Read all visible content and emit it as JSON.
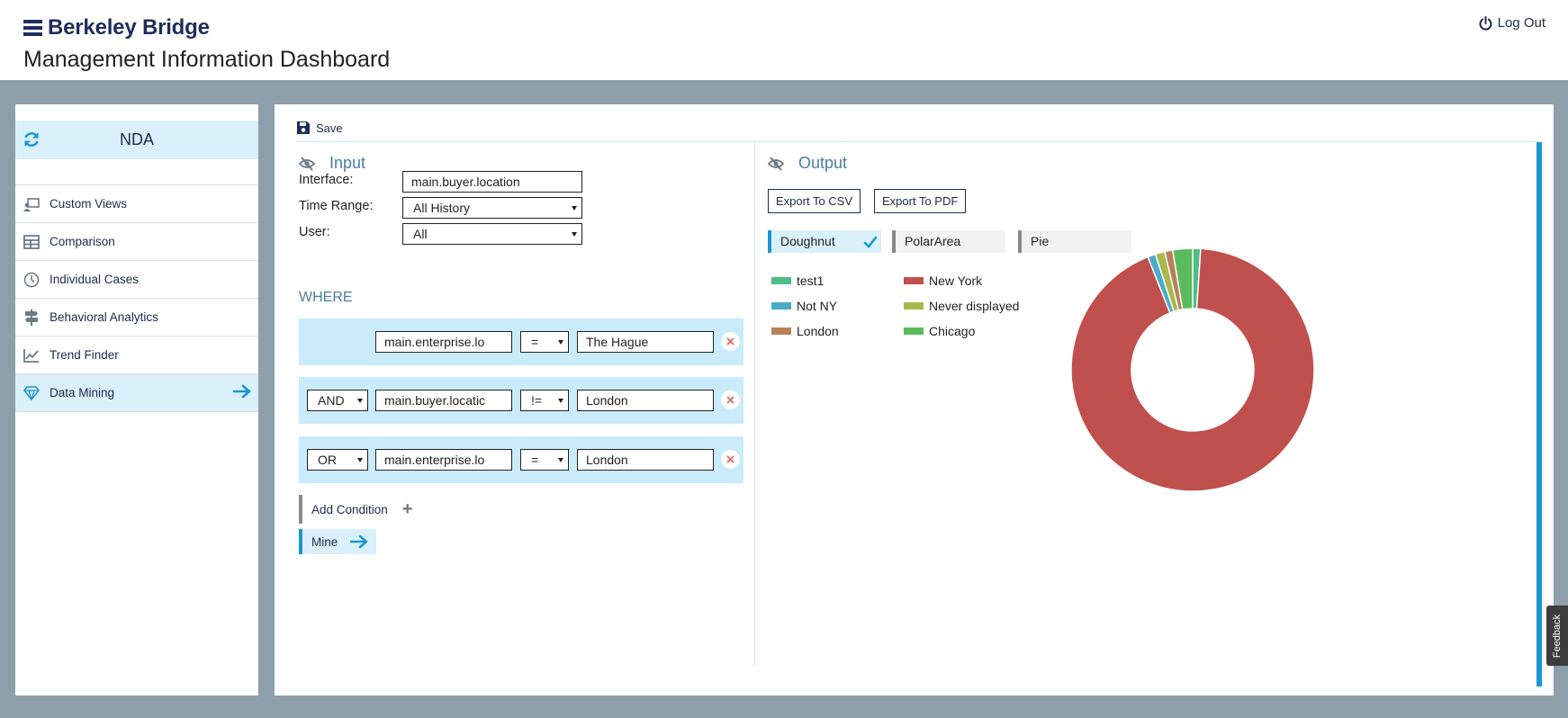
{
  "header": {
    "brand": "Berkeley Bridge",
    "title": "Management Information Dashboard",
    "logout_label": "Log Out"
  },
  "sidebar": {
    "header_label": "NDA",
    "items": [
      {
        "label": "Custom Views",
        "icon": "custom-views-icon"
      },
      {
        "label": "Comparison",
        "icon": "table-icon"
      },
      {
        "label": "Individual Cases",
        "icon": "clock-icon"
      },
      {
        "label": "Behavioral Analytics",
        "icon": "signpost-icon"
      },
      {
        "label": "Trend Finder",
        "icon": "line-chart-icon"
      },
      {
        "label": "Data Mining",
        "icon": "diamond-icon",
        "active": true
      }
    ]
  },
  "toolbar": {
    "save_label": "Save"
  },
  "input": {
    "heading": "Input",
    "interface_label": "Interface:",
    "interface_value": "main.buyer.location",
    "time_range_label": "Time Range:",
    "time_range_value": "All History",
    "user_label": "User:",
    "user_value": "All",
    "where_label": "WHERE",
    "conditions": [
      {
        "connector": "",
        "field": "main.enterprise.lo",
        "operator": "=",
        "value": "The Hague"
      },
      {
        "connector": "AND",
        "field": "main.buyer.locatic",
        "operator": "!=",
        "value": "London"
      },
      {
        "connector": "OR",
        "field": "main.enterprise.lo",
        "operator": "=",
        "value": "London"
      }
    ],
    "add_condition_label": "Add Condition",
    "mine_label": "Mine"
  },
  "output": {
    "heading": "Output",
    "export_csv_label": "Export To CSV",
    "export_pdf_label": "Export To PDF",
    "chart_tabs": [
      {
        "label": "Doughnut",
        "active": true
      },
      {
        "label": "PolarArea",
        "active": false
      },
      {
        "label": "Pie",
        "active": false
      }
    ]
  },
  "feedback_label": "Feedback",
  "chart_data": {
    "type": "pie",
    "variant": "doughnut",
    "legend_placement": "left",
    "series": [
      {
        "name": "test1",
        "value": 1,
        "color": "#4dbd8a"
      },
      {
        "name": "New York",
        "value": 88,
        "color": "#c0504d"
      },
      {
        "name": "Not NY",
        "value": 1,
        "color": "#4bacc6"
      },
      {
        "name": "Never displayed",
        "value": 1.2,
        "color": "#a8b94b"
      },
      {
        "name": "London",
        "value": 1,
        "color": "#b8805a"
      },
      {
        "name": "Chicago",
        "value": 2.5,
        "color": "#5bbb5b"
      }
    ]
  }
}
